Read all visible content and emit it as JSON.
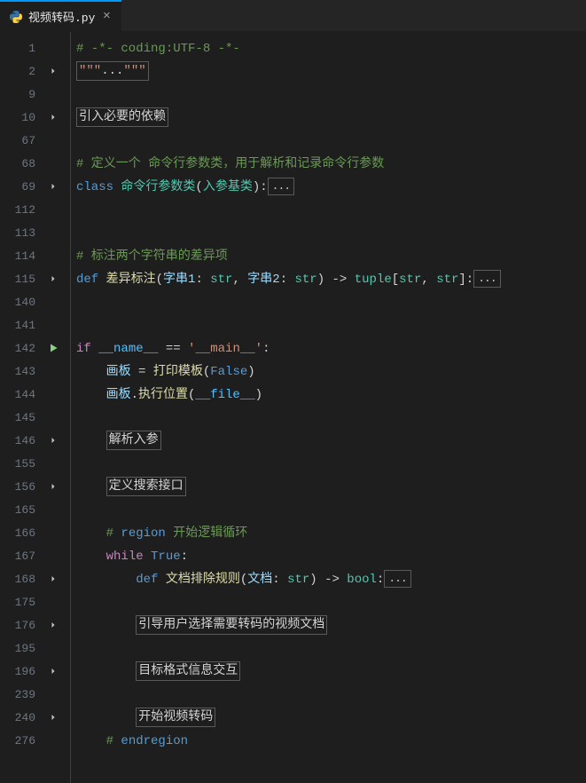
{
  "tab": {
    "filename": "视频转码.py",
    "icon": "python-icon"
  },
  "editor": {
    "lines": [
      {
        "num": "1",
        "fold": "",
        "code": [
          {
            "cls": "c-comment",
            "t": "# -*- coding:UTF-8 -*-"
          }
        ]
      },
      {
        "num": "2",
        "fold": "chev",
        "code": [
          {
            "boxed": true,
            "segments": [
              {
                "cls": "c-str",
                "t": "\"\"\""
              },
              {
                "cls": "c-white",
                "t": "..."
              },
              {
                "cls": "c-str",
                "t": "\"\"\""
              }
            ]
          }
        ]
      },
      {
        "num": "9",
        "fold": "",
        "code": []
      },
      {
        "num": "10",
        "fold": "chev",
        "code": [
          {
            "boxed": true,
            "segments": [
              {
                "cls": "c-white",
                "t": "引入必要的依赖"
              }
            ]
          }
        ]
      },
      {
        "num": "67",
        "fold": "",
        "code": []
      },
      {
        "num": "68",
        "fold": "",
        "code": [
          {
            "cls": "c-comment",
            "t": "# 定义一个 命令行参数类，用于解析和记录命令行参数"
          }
        ]
      },
      {
        "num": "69",
        "fold": "chev",
        "code": [
          {
            "cls": "c-def",
            "t": "class"
          },
          {
            "cls": "c-white",
            "t": " "
          },
          {
            "cls": "c-class",
            "t": "命令行参数类"
          },
          {
            "cls": "c-white",
            "t": "("
          },
          {
            "cls": "c-class",
            "t": "入参基类"
          },
          {
            "cls": "c-white",
            "t": "):"
          },
          {
            "ellipsis": true
          }
        ]
      },
      {
        "num": "112",
        "fold": "",
        "code": []
      },
      {
        "num": "113",
        "fold": "",
        "code": []
      },
      {
        "num": "114",
        "fold": "",
        "code": [
          {
            "cls": "c-comment",
            "t": "# 标注两个字符串的差异项"
          }
        ]
      },
      {
        "num": "115",
        "fold": "chev",
        "code": [
          {
            "cls": "c-def",
            "t": "def"
          },
          {
            "cls": "c-white",
            "t": " "
          },
          {
            "cls": "c-fn",
            "t": "差异标注"
          },
          {
            "cls": "c-white",
            "t": "("
          },
          {
            "cls": "c-var",
            "t": "字串1"
          },
          {
            "cls": "c-white",
            "t": ": "
          },
          {
            "cls": "c-type",
            "t": "str"
          },
          {
            "cls": "c-white",
            "t": ", "
          },
          {
            "cls": "c-var",
            "t": "字串2"
          },
          {
            "cls": "c-white",
            "t": ": "
          },
          {
            "cls": "c-type",
            "t": "str"
          },
          {
            "cls": "c-white",
            "t": ") -> "
          },
          {
            "cls": "c-type",
            "t": "tuple"
          },
          {
            "cls": "c-white",
            "t": "["
          },
          {
            "cls": "c-type",
            "t": "str"
          },
          {
            "cls": "c-white",
            "t": ", "
          },
          {
            "cls": "c-type",
            "t": "str"
          },
          {
            "cls": "c-white",
            "t": "]:"
          },
          {
            "ellipsis": true
          }
        ]
      },
      {
        "num": "140",
        "fold": "",
        "code": []
      },
      {
        "num": "141",
        "fold": "",
        "code": []
      },
      {
        "num": "142",
        "fold": "run",
        "code": [
          {
            "cls": "c-kw",
            "t": "if"
          },
          {
            "cls": "c-white",
            "t": " "
          },
          {
            "cls": "c-varc",
            "t": "__name__"
          },
          {
            "cls": "c-white",
            "t": " == "
          },
          {
            "cls": "c-str",
            "t": "'__main__'"
          },
          {
            "cls": "c-white",
            "t": ":"
          }
        ]
      },
      {
        "num": "143",
        "fold": "",
        "code": [
          {
            "indent": 1
          },
          {
            "cls": "c-var",
            "t": "画板"
          },
          {
            "cls": "c-white",
            "t": " = "
          },
          {
            "cls": "c-fn",
            "t": "打印模板"
          },
          {
            "cls": "c-white",
            "t": "("
          },
          {
            "cls": "c-const",
            "t": "False"
          },
          {
            "cls": "c-white",
            "t": ")"
          }
        ]
      },
      {
        "num": "144",
        "fold": "",
        "code": [
          {
            "indent": 1
          },
          {
            "cls": "c-var",
            "t": "画板"
          },
          {
            "cls": "c-white",
            "t": "."
          },
          {
            "cls": "c-fn",
            "t": "执行位置"
          },
          {
            "cls": "c-white",
            "t": "("
          },
          {
            "cls": "c-varc",
            "t": "__file__"
          },
          {
            "cls": "c-white",
            "t": ")"
          }
        ]
      },
      {
        "num": "145",
        "fold": "",
        "code": []
      },
      {
        "num": "146",
        "fold": "chev",
        "code": [
          {
            "indent": 1
          },
          {
            "boxed": true,
            "segments": [
              {
                "cls": "c-white",
                "t": "解析入参"
              }
            ]
          }
        ]
      },
      {
        "num": "155",
        "fold": "",
        "code": []
      },
      {
        "num": "156",
        "fold": "chev",
        "code": [
          {
            "indent": 1
          },
          {
            "boxed": true,
            "segments": [
              {
                "cls": "c-white",
                "t": "定义搜索接口"
              }
            ]
          }
        ]
      },
      {
        "num": "165",
        "fold": "",
        "code": []
      },
      {
        "num": "166",
        "fold": "",
        "code": [
          {
            "indent": 1
          },
          {
            "cls": "c-comment",
            "t": "# "
          },
          {
            "cls": "c-def",
            "t": "region"
          },
          {
            "cls": "c-comment",
            "t": " 开始逻辑循环"
          }
        ]
      },
      {
        "num": "167",
        "fold": "",
        "code": [
          {
            "indent": 1
          },
          {
            "cls": "c-kw",
            "t": "while"
          },
          {
            "cls": "c-white",
            "t": " "
          },
          {
            "cls": "c-const",
            "t": "True"
          },
          {
            "cls": "c-white",
            "t": ":"
          }
        ]
      },
      {
        "num": "168",
        "fold": "chev",
        "code": [
          {
            "indent": 2
          },
          {
            "cls": "c-def",
            "t": "def"
          },
          {
            "cls": "c-white",
            "t": " "
          },
          {
            "cls": "c-fn",
            "t": "文档排除规则"
          },
          {
            "cls": "c-white",
            "t": "("
          },
          {
            "cls": "c-var",
            "t": "文档"
          },
          {
            "cls": "c-white",
            "t": ": "
          },
          {
            "cls": "c-type",
            "t": "str"
          },
          {
            "cls": "c-white",
            "t": ") -> "
          },
          {
            "cls": "c-type",
            "t": "bool"
          },
          {
            "cls": "c-white",
            "t": ":"
          },
          {
            "ellipsis": true
          }
        ]
      },
      {
        "num": "175",
        "fold": "",
        "code": []
      },
      {
        "num": "176",
        "fold": "chev",
        "code": [
          {
            "indent": 2
          },
          {
            "boxed": true,
            "segments": [
              {
                "cls": "c-white",
                "t": "引导用户选择需要转码的视频文档"
              }
            ]
          }
        ]
      },
      {
        "num": "195",
        "fold": "",
        "code": []
      },
      {
        "num": "196",
        "fold": "chev",
        "code": [
          {
            "indent": 2
          },
          {
            "boxed": true,
            "segments": [
              {
                "cls": "c-white",
                "t": "目标格式信息交互"
              }
            ]
          }
        ]
      },
      {
        "num": "239",
        "fold": "",
        "code": []
      },
      {
        "num": "240",
        "fold": "chev",
        "code": [
          {
            "indent": 2
          },
          {
            "boxed": true,
            "segments": [
              {
                "cls": "c-white",
                "t": "开始视频转码"
              }
            ]
          }
        ]
      },
      {
        "num": "276",
        "fold": "",
        "code": [
          {
            "indent": 1
          },
          {
            "cls": "c-comment",
            "t": "# "
          },
          {
            "cls": "c-def",
            "t": "endregion"
          }
        ]
      }
    ]
  }
}
